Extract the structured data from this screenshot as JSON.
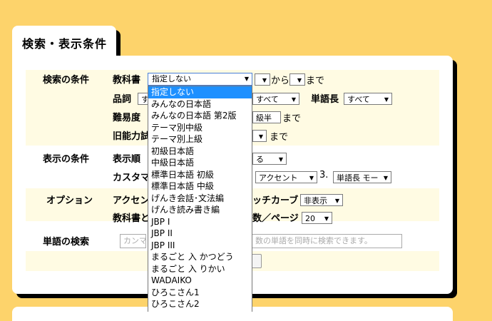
{
  "tab_title": "検索・表示条件",
  "rows": {
    "search": "検索の条件",
    "display": "表示の条件",
    "option": "オプション",
    "word_search": "単語の検索"
  },
  "fields": {
    "textbook": "教科書",
    "from": "から",
    "to": "まで",
    "pos": "品詞",
    "pos_value": "す",
    "all1": "すべて",
    "word_length": "単語長",
    "all2": "すべて",
    "difficulty": "難易度",
    "difficulty_value": "級半",
    "to2": "まで",
    "old_level": "旧能力試",
    "to3": "まで",
    "display_order": "表示順",
    "order_value": "る",
    "custom": "カスタマ",
    "accent_sel": "アクセント",
    "num3": "3.",
    "wordlen_sel": "単語長 モー",
    "accent_opt": "アクセン",
    "pitch_curve": "ッチカーブ",
    "pitch_value": "非表示",
    "textbook_opt": "教科書と",
    "per_page": "数／ページ",
    "per_page_value": "20",
    "search_placeholder_left": "カンマ",
    "search_placeholder_right": "数の単語を同時に検索できます。"
  },
  "dropdown": {
    "selected": "指定しない",
    "options": [
      "指定しない",
      "みんなの日本語",
      "みんなの日本語 第2版",
      "テーマ別中級",
      "テーマ別上級",
      "初級日本語",
      "中級日本語",
      "標準日本語 初級",
      "標準日本語 中級",
      "げんき会話･文法編",
      "げんき読み書き編",
      "JBP I",
      "JBP II",
      "JBP III",
      "まるごと 入 かつどう",
      "まるごと 入 りかい",
      "WADAIKO",
      "ひろこさん1",
      "ひろこさん2"
    ],
    "highlighted_index": 0
  }
}
